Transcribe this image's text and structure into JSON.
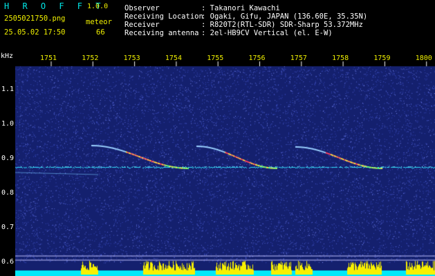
{
  "header": {
    "logo": "H R O F F T",
    "version": "1.0.0",
    "filename": "2505021750.png",
    "datetime": "25.05.02 17:50",
    "event_label": "meteor",
    "event_count": "66",
    "fields": [
      {
        "label": "Observer",
        "value": ": Takanori Kawachi"
      },
      {
        "label": "Receiving Location",
        "value": ": Ogaki, Gifu, JAPAN (136.60E, 35.35N)"
      },
      {
        "label": "Receiver",
        "value": ": R820T2(RTL-SDR) SDR-Sharp 53.372MHz"
      },
      {
        "label": "Receiving antenna",
        "value": ": 2el-HB9CV Vertical (el. E-W)"
      }
    ]
  },
  "spectrogram": {
    "y_unit": "kHz",
    "y_ticks": [
      "1.1",
      "1.0",
      "0.9",
      "0.8",
      "0.7",
      "0.6"
    ],
    "x_ticks": [
      "1751",
      "1752",
      "1753",
      "1754",
      "1755",
      "1756",
      "1757",
      "1758",
      "1759",
      "1800"
    ],
    "colors": {
      "background": "#14206e",
      "noise": "#3a4cc0",
      "carrier": "#30e0ff",
      "echo_hot": "#ff4060",
      "echo_mid": "#ffe040",
      "floor": "#00e8f8",
      "floor_peaks": "#f8f000"
    }
  }
}
